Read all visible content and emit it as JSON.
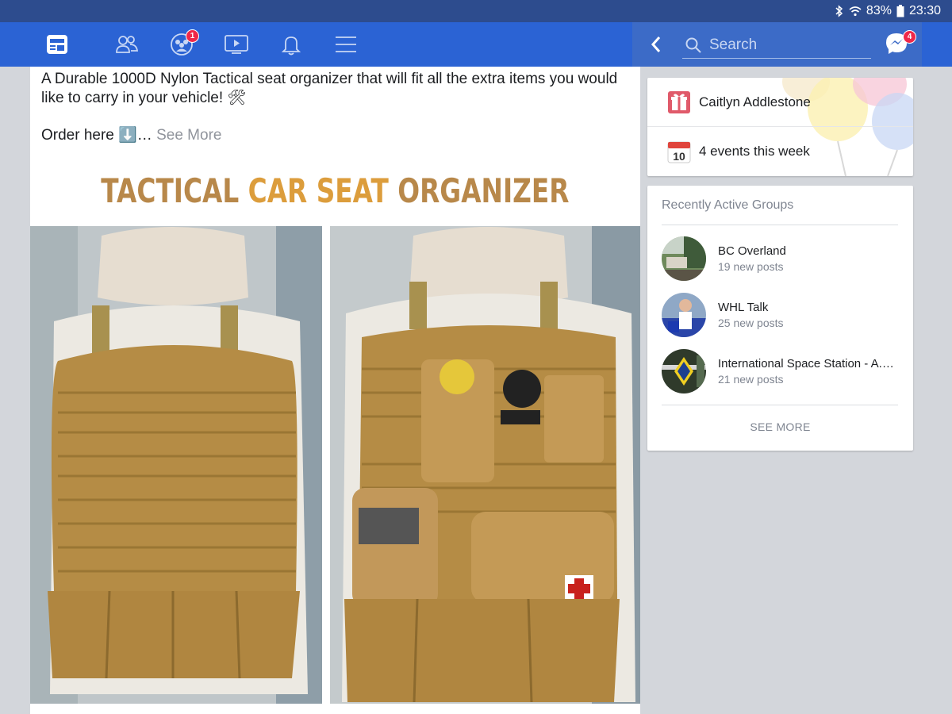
{
  "status_bar": {
    "battery": "83%",
    "time": "23:30"
  },
  "nav": {
    "groups_badge": "1",
    "search_placeholder": "Search",
    "messenger_badge": "4"
  },
  "post": {
    "text_line1": "A Durable 1000D Nylon Tactical seat organizer that will fit all the extra items you would",
    "text_line2": "like to carry in your vehicle! 🛠",
    "order_text": "Order here ⬇️…",
    "see_more": "See More",
    "image_title_1": "TACTICAL",
    "image_title_2": "CAR SEAT",
    "image_title_3": "ORGANIZER"
  },
  "shortcuts": {
    "birthday": "Caitlyn Addlestone",
    "calendar_day": "10",
    "events": "4 events this week"
  },
  "groups": {
    "title": "Recently Active Groups",
    "items": [
      {
        "name": "BC Overland",
        "sub": "19 new posts"
      },
      {
        "name": "WHL Talk",
        "sub": "25 new posts"
      },
      {
        "name": "International Space Station - A.R.I.S.S.",
        "sub": "21 new posts"
      }
    ],
    "see_more": "SEE MORE"
  },
  "colors": {
    "status_bar": "#2d4c8e",
    "nav_bar": "#2b63d4",
    "badge": "#f02849",
    "tan": "#b8884a"
  }
}
